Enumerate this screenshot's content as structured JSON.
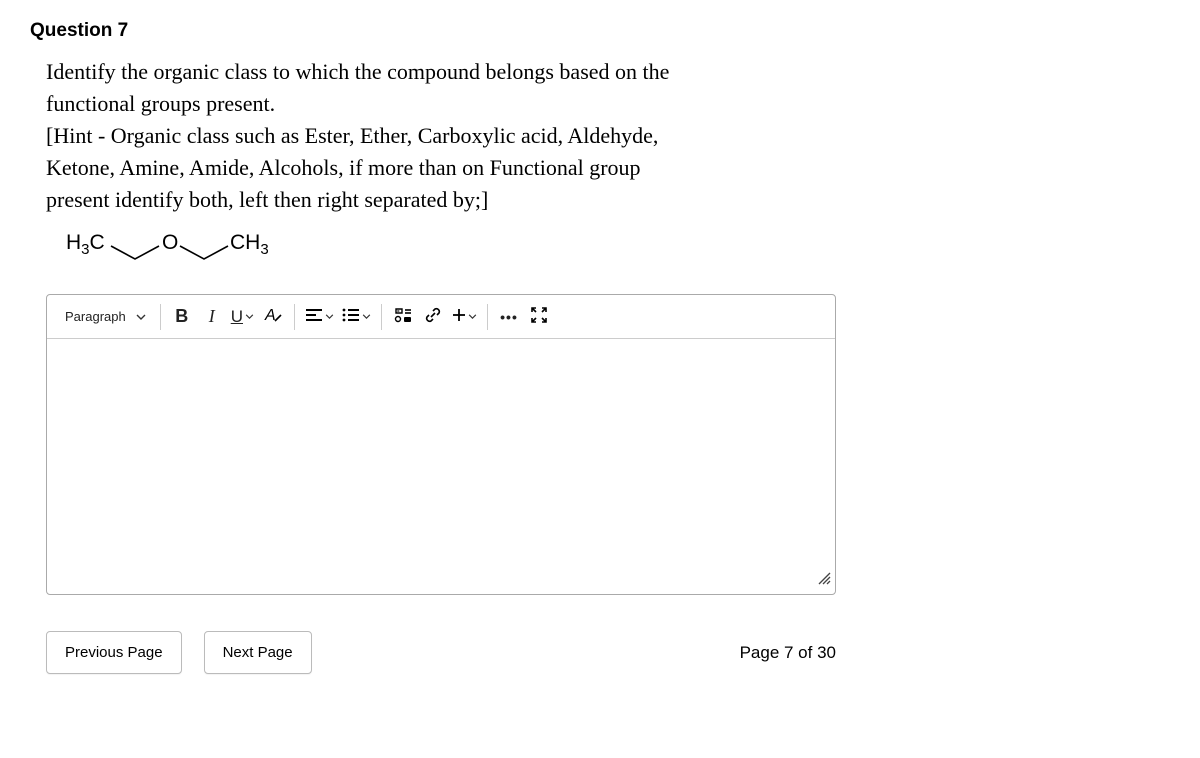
{
  "question": {
    "label": "Question 7",
    "prompt_line1": "Identify the organic class to which the compound belongs based on the",
    "prompt_line2": "functional groups present.",
    "hint_line1": " [Hint - Organic class such as Ester, Ether, Carboxylic acid, Aldehyde,",
    "hint_line2": "Ketone, Amine, Amide, Alcohols, if more than on Functional group",
    "hint_line3": "present identify both, left then right separated by;]"
  },
  "chemical": {
    "left_label": "H",
    "left_sub": "3",
    "left_after": "C",
    "center_label": "O",
    "right_label": "CH",
    "right_sub": "3"
  },
  "toolbar": {
    "paragraph": "Paragraph",
    "bold": "B",
    "italic": "I",
    "underline": "U",
    "clear_format": "A",
    "more": "•••",
    "plus": "+"
  },
  "footer": {
    "prev": "Previous Page",
    "next": "Next Page",
    "page": "Page 7 of 30"
  }
}
